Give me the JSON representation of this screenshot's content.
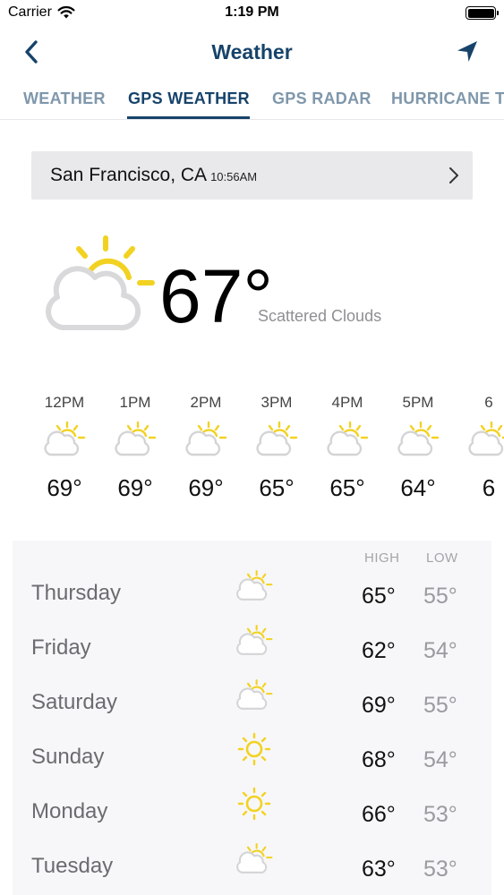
{
  "status_bar": {
    "carrier": "Carrier",
    "time": "1:19 PM",
    "battery_level": 1.0
  },
  "nav": {
    "title": "Weather",
    "back_icon": "chevron-left-icon",
    "location_icon": "location-arrow-icon",
    "accent_color": "#17436a"
  },
  "tabs": [
    {
      "label": "WEATHER",
      "active": false
    },
    {
      "label": "GPS WEATHER",
      "active": true
    },
    {
      "label": "GPS RADAR",
      "active": false
    },
    {
      "label": "HURRICANE T",
      "active": false
    }
  ],
  "location": {
    "city": "San Francisco, CA",
    "time": "10:56AM"
  },
  "current": {
    "temperature": "67°",
    "condition": "Scattered Clouds",
    "icon": "partly-cloudy-icon"
  },
  "hourly": [
    {
      "time": "12PM",
      "temp": "69°",
      "icon": "partly-cloudy-icon"
    },
    {
      "time": "1PM",
      "temp": "69°",
      "icon": "partly-cloudy-icon"
    },
    {
      "time": "2PM",
      "temp": "69°",
      "icon": "partly-cloudy-icon"
    },
    {
      "time": "3PM",
      "temp": "65°",
      "icon": "partly-cloudy-icon"
    },
    {
      "time": "4PM",
      "temp": "65°",
      "icon": "partly-cloudy-icon"
    },
    {
      "time": "5PM",
      "temp": "64°",
      "icon": "partly-cloudy-icon"
    },
    {
      "time": "6",
      "temp": "6",
      "icon": "partly-cloudy-icon"
    }
  ],
  "daily": {
    "high_label": "HIGH",
    "low_label": "LOW",
    "days": [
      {
        "day": "Thursday",
        "high": "65°",
        "low": "55°",
        "icon": "partly-cloudy-icon"
      },
      {
        "day": "Friday",
        "high": "62°",
        "low": "54°",
        "icon": "partly-cloudy-icon"
      },
      {
        "day": "Saturday",
        "high": "69°",
        "low": "55°",
        "icon": "partly-cloudy-icon"
      },
      {
        "day": "Sunday",
        "high": "68°",
        "low": "54°",
        "icon": "sun-icon"
      },
      {
        "day": "Monday",
        "high": "66°",
        "low": "53°",
        "icon": "sun-icon"
      },
      {
        "day": "Tuesday",
        "high": "63°",
        "low": "53°",
        "icon": "partly-cloudy-icon"
      }
    ]
  },
  "colors": {
    "sun": "#f2d221",
    "cloud_outline": "#d4d4d6",
    "tab_inactive": "#7f97ab"
  }
}
